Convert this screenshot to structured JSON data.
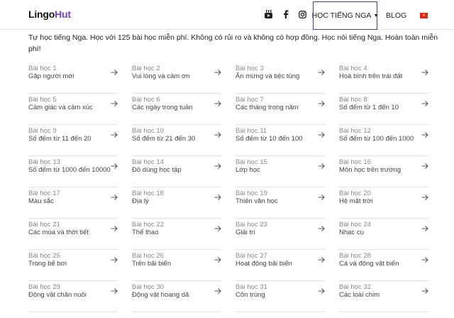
{
  "header": {
    "logo_left": "Lingo",
    "logo_right": "Hut",
    "course_menu": "HỌC TIẾNG NGA",
    "blog": "BLOG",
    "social_icons": [
      "youtube-icon",
      "facebook-icon",
      "instagram-icon"
    ],
    "flag_icon": "vietnam-flag-icon"
  },
  "intro": "Tự học tiếng Nga. Học với 125 bài học miễn phí. Không có rủi ro và không có hợp đồng. Học nói tiếng Nga. Hoàn toàn miễn phí!",
  "colors": {
    "accent": "#7a3cc9",
    "nav_border": "#3b3fa8",
    "flag_red": "#da251d",
    "flag_star": "#ffde00"
  },
  "lessons": [
    {
      "num": "Bài học 1",
      "title": "Gặp người mới"
    },
    {
      "num": "Bài học 2",
      "title": "Vui lòng và cảm ơn"
    },
    {
      "num": "Bài học 3",
      "title": "Ăn mừng và tiệc tùng"
    },
    {
      "num": "Bài học 4",
      "title": "Hoà bình trên trái đất"
    },
    {
      "num": "Bài học 5",
      "title": "Cảm giác và cảm xúc"
    },
    {
      "num": "Bài học 6",
      "title": "Các ngày trong tuần"
    },
    {
      "num": "Bài học 7",
      "title": "Các tháng trong năm"
    },
    {
      "num": "Bài học 8",
      "title": "Số đếm từ 1 đến 10"
    },
    {
      "num": "Bài học 9",
      "title": "Số đếm từ 11 đến 20"
    },
    {
      "num": "Bài học 10",
      "title": "Số đếm từ 21 đến 30"
    },
    {
      "num": "Bài học 11",
      "title": "Số đếm từ 10 đến 100"
    },
    {
      "num": "Bài học 12",
      "title": "Số đếm từ 100 đến 1000"
    },
    {
      "num": "Bài học 13",
      "title": "Số đếm từ 1000 đến 10000"
    },
    {
      "num": "Bài học 14",
      "title": "Đồ dùng học tập"
    },
    {
      "num": "Bài học 15",
      "title": "Lớp học"
    },
    {
      "num": "Bài học 16",
      "title": "Môn học trên trường"
    },
    {
      "num": "Bài học 17",
      "title": "Màu sắc"
    },
    {
      "num": "Bài học 18",
      "title": "Địa lý"
    },
    {
      "num": "Bài học 19",
      "title": "Thiên văn học"
    },
    {
      "num": "Bài học 20",
      "title": "Hệ mặt trời"
    },
    {
      "num": "Bài học 21",
      "title": "Các mùa và thời tiết"
    },
    {
      "num": "Bài học 22",
      "title": "Thể thao"
    },
    {
      "num": "Bài học 23",
      "title": "Giải trí"
    },
    {
      "num": "Bài học 24",
      "title": "Nhạc cụ"
    },
    {
      "num": "Bài học 25",
      "title": "Trong bể bơi"
    },
    {
      "num": "Bài học 26",
      "title": "Trên bãi biển"
    },
    {
      "num": "Bài học 27",
      "title": "Hoạt động bãi biển"
    },
    {
      "num": "Bài học 28",
      "title": "Cá và động vật biển"
    },
    {
      "num": "Bài học 29",
      "title": "Động vật chăn nuôi"
    },
    {
      "num": "Bài học 30",
      "title": "Động vật hoang dã"
    },
    {
      "num": "Bài học 31",
      "title": "Côn trùng"
    },
    {
      "num": "Bài học 32",
      "title": "Các loài chim"
    }
  ]
}
